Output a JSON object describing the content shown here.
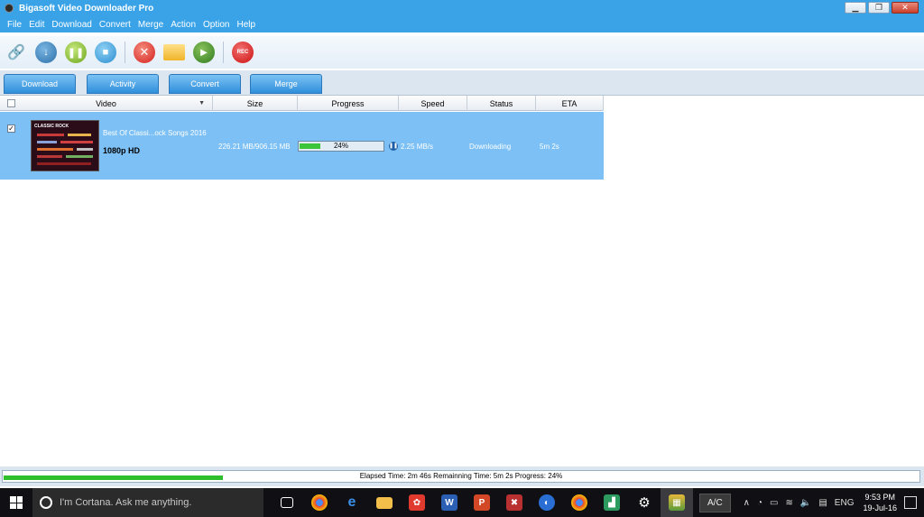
{
  "window": {
    "title": "Bigasoft Video Downloader Pro",
    "buttons": {
      "minimize": "▁",
      "maximize": "❐",
      "close": "✕"
    }
  },
  "menu": [
    "File",
    "Edit",
    "Download",
    "Convert",
    "Merge",
    "Action",
    "Option",
    "Help"
  ],
  "toolbar": {
    "icons": [
      "add-link-icon",
      "download-icon",
      "pause-icon",
      "stop-icon",
      "delete-icon",
      "folder-icon",
      "play-icon",
      "record-icon"
    ],
    "record_label": "REC"
  },
  "tabs": [
    "Download",
    "Activity",
    "Convert",
    "Merge"
  ],
  "columns": [
    "Video",
    "Size",
    "Progress",
    "Speed",
    "Status",
    "ETA"
  ],
  "downloads": [
    {
      "checked": true,
      "thumbnail_text": "CLASSIC ROCK",
      "title": "Best Of Classi...ock Songs 2016",
      "quality": "1080p HD",
      "size": "226.21 MB/906.15 MB",
      "progress_pct": 24,
      "progress_label": "24%",
      "speed": "2.25 MB/s",
      "status": "Downloading",
      "eta": "5m  2s"
    }
  ],
  "statusbar": {
    "text": "Elapsed Time: 2m 46s Remainning Time: 5m  2s Progress: 24%",
    "progress_pct": 24
  },
  "taskbar": {
    "search_placeholder": "I'm Cortana. Ask me anything.",
    "ac_label": "A/C",
    "language": "ENG",
    "time": "9:53 PM",
    "date": "19-Jul-16"
  },
  "colors": {
    "title_bar": "#3aa3e8",
    "row_selected": "#7cc0f5",
    "progress_green": "#3cc43a"
  }
}
